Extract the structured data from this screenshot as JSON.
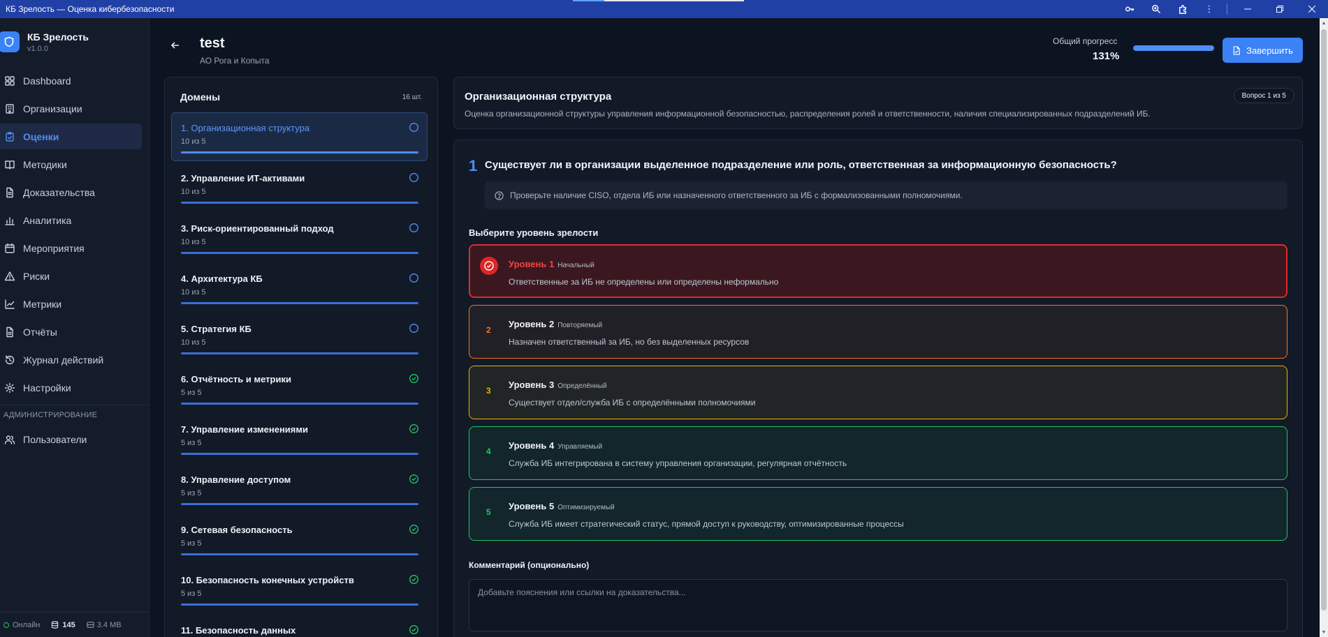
{
  "window": {
    "title": "КБ Зрелость — Оценка кибербезопасности"
  },
  "sidebar": {
    "app_name": "КБ Зрелость",
    "version": "v1.0.0",
    "items": [
      {
        "label": "Dashboard",
        "icon": "dashboard-icon"
      },
      {
        "label": "Организации",
        "icon": "building-icon"
      },
      {
        "label": "Оценки",
        "icon": "clipboard-icon"
      },
      {
        "label": "Методики",
        "icon": "book-icon"
      },
      {
        "label": "Доказательства",
        "icon": "file-icon"
      },
      {
        "label": "Аналитика",
        "icon": "bar-chart-icon"
      },
      {
        "label": "Мероприятия",
        "icon": "calendar-icon"
      },
      {
        "label": "Риски",
        "icon": "warning-icon"
      },
      {
        "label": "Метрики",
        "icon": "trend-icon"
      },
      {
        "label": "Отчёты",
        "icon": "report-icon"
      },
      {
        "label": "Журнал действий",
        "icon": "history-icon"
      },
      {
        "label": "Настройки",
        "icon": "gear-icon"
      }
    ],
    "active_index": 2,
    "admin_section": "АДМИНИСТРИРОВАНИЕ",
    "admin_items": [
      {
        "label": "Пользователи",
        "icon": "users-icon"
      }
    ],
    "footer": {
      "status": "Онлайн",
      "records": "145",
      "size": "3.4 MB"
    }
  },
  "header": {
    "title": "test",
    "subtitle": "АО Рога и Копыта",
    "progress_label": "Общий прогресс",
    "progress_value": "131%",
    "progress_fraction": 1.0,
    "finish_label": "Завершить"
  },
  "domains": {
    "title": "Домены",
    "count": "16 шт.",
    "items": [
      {
        "name": "1. Организационная структура",
        "progress": "10 из 5",
        "status": "in-progress",
        "active": true
      },
      {
        "name": "2. Управление ИТ-активами",
        "progress": "10 из 5",
        "status": "in-progress",
        "active": false
      },
      {
        "name": "3. Риск-ориентированный подход",
        "progress": "10 из 5",
        "status": "in-progress",
        "active": false
      },
      {
        "name": "4. Архитектура КБ",
        "progress": "10 из 5",
        "status": "in-progress",
        "active": false
      },
      {
        "name": "5. Стратегия КБ",
        "progress": "10 из 5",
        "status": "in-progress",
        "active": false
      },
      {
        "name": "6. Отчётность и метрики",
        "progress": "5 из 5",
        "status": "done",
        "active": false
      },
      {
        "name": "7. Управление изменениями",
        "progress": "5 из 5",
        "status": "done",
        "active": false
      },
      {
        "name": "8. Управление доступом",
        "progress": "5 из 5",
        "status": "done",
        "active": false
      },
      {
        "name": "9. Сетевая безопасность",
        "progress": "5 из 5",
        "status": "done",
        "active": false
      },
      {
        "name": "10. Безопасность конечных устройств",
        "progress": "5 из 5",
        "status": "done",
        "active": false
      },
      {
        "name": "11. Безопасность данных",
        "progress": "",
        "status": "done",
        "active": false
      }
    ]
  },
  "domain_info": {
    "title": "Организационная структура",
    "description": "Оценка организационной структуры управления информационной безопасностью, распределения ролей и ответственности, наличия специализированных подразделений ИБ.",
    "question_badge": "Вопрос 1 из 5"
  },
  "question": {
    "number": "1",
    "text": "Существует ли в организации выделенное подразделение или роль, ответственная за информационную безопасность?",
    "hint": "Проверьте наличие CISO, отдела ИБ или назначенного ответственного за ИБ с формализованными полномочиями.",
    "levels_label": "Выберите уровень зрелости",
    "selected_level": 1,
    "levels": [
      {
        "num": "1",
        "title": "Уровень 1",
        "tag": "Начальный",
        "desc": "Ответственные за ИБ не определены или определены неформально",
        "color": "#dc2b2f"
      },
      {
        "num": "2",
        "title": "Уровень 2",
        "tag": "Повторяемый",
        "desc": "Назначен ответственный за ИБ, но без выделенных ресурсов",
        "color": "#f97316"
      },
      {
        "num": "3",
        "title": "Уровень 3",
        "tag": "Определённый",
        "desc": "Существует отдел/служба ИБ с определёнными полномочиями",
        "color": "#eab308"
      },
      {
        "num": "4",
        "title": "Уровень 4",
        "tag": "Управляемый",
        "desc": "Служба ИБ интегрирована в систему управления организации, регулярная отчётность",
        "color": "#22c55e"
      },
      {
        "num": "5",
        "title": "Уровень 5",
        "tag": "Оптимизируемый",
        "desc": "Служба ИБ имеет стратегический статус, прямой доступ к руководству, оптимизированные процессы",
        "color": "#22c55e"
      }
    ],
    "comment_label": "Комментарий (опционально)",
    "comment_placeholder": "Добавьте пояснения или ссылки на доказательства..."
  },
  "colors": {
    "accent": "#3b82f6",
    "background": "#0d1421",
    "panel": "#121a28",
    "titlebar": "#2140a6",
    "level1": "#dc2b2f",
    "level2": "#f97316",
    "level3": "#eab308",
    "level4": "#22c55e",
    "level5": "#22c55e"
  }
}
